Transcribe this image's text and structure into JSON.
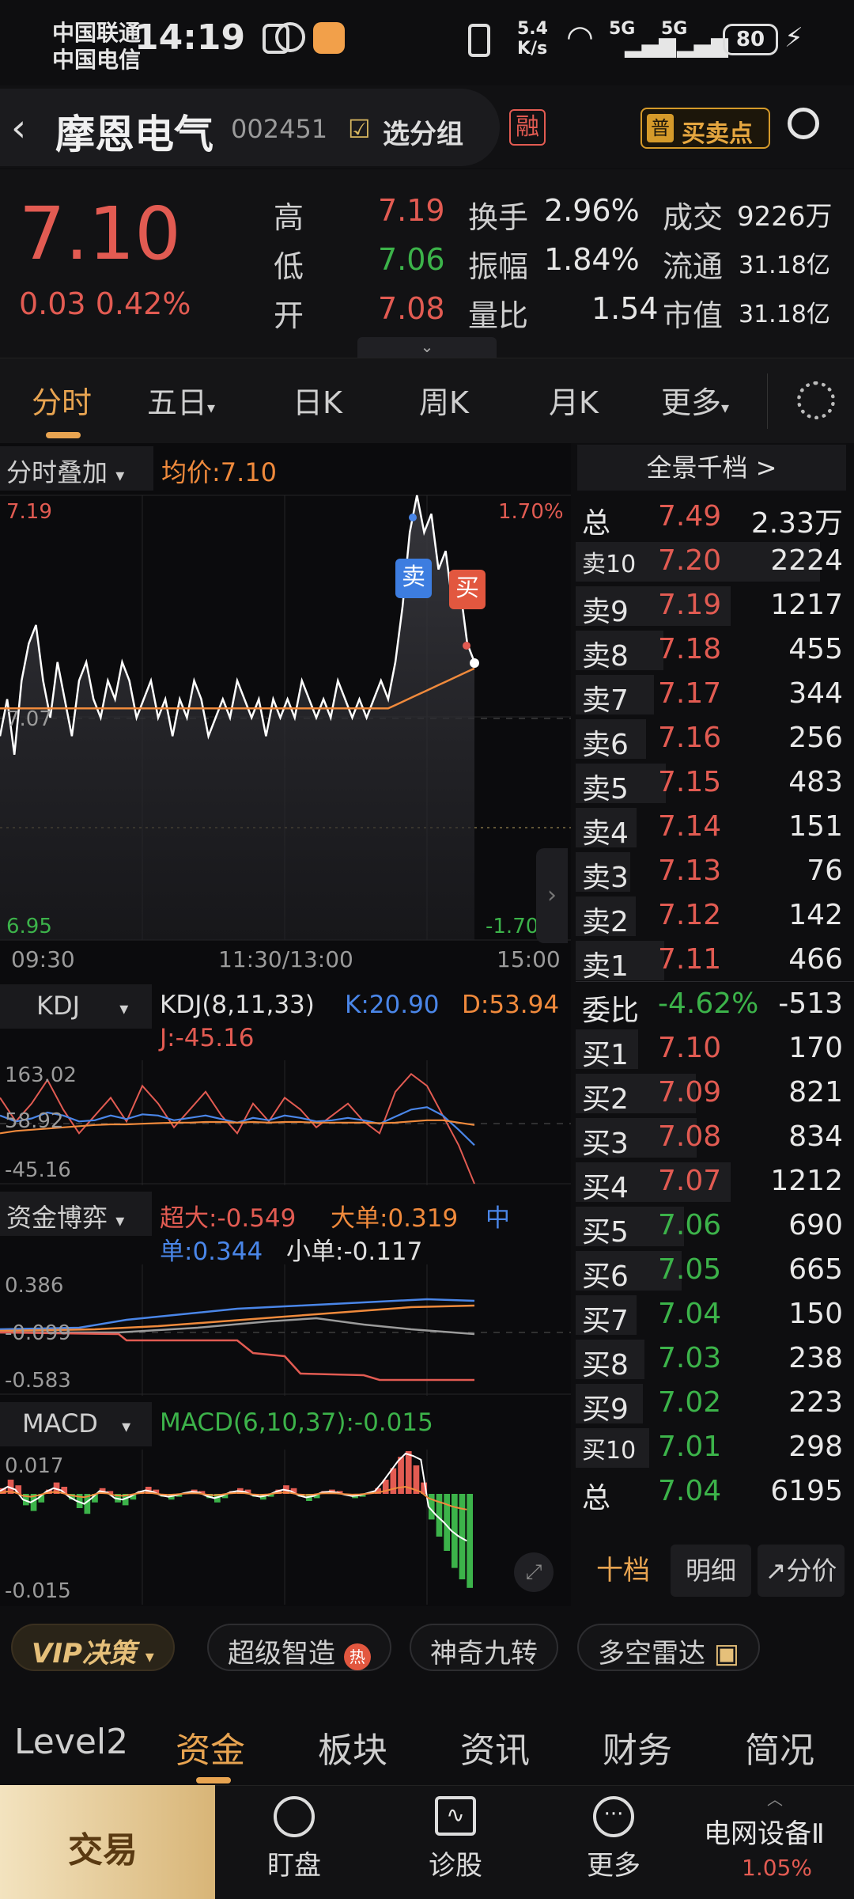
{
  "status": {
    "carrier1": "中国联通",
    "carrier2": "中国电信",
    "time": "14:19",
    "net_speed_top": "5.4",
    "net_speed_bot": "K/s",
    "sig1": "5G",
    "sig2": "5G",
    "battery": "80"
  },
  "header": {
    "name": "摩恩电气",
    "code": "002451",
    "group_label": "选分组",
    "rong": "融",
    "buysell_badge": "普",
    "buysell": "买卖点"
  },
  "quote": {
    "price": "7.10",
    "change": "0.03",
    "change_pct": "0.42%",
    "high_label": "高",
    "high": "7.19",
    "low_label": "低",
    "low": "7.06",
    "open_label": "开",
    "open": "7.08",
    "turnover_label": "换手",
    "turnover": "2.96%",
    "amp_label": "振幅",
    "amp": "1.84%",
    "vr_label": "量比",
    "vr": "1.54",
    "vol_label": "成交",
    "vol": "9226万",
    "float_label": "流通",
    "float": "31.18亿",
    "mcap_label": "市值",
    "mcap": "31.18亿"
  },
  "tabs": [
    "分时",
    "五日",
    "日K",
    "周K",
    "月K",
    "更多"
  ],
  "intraday": {
    "overlay_label": "分时叠加",
    "avg_label": "均价:7.10",
    "y_top": "7.19",
    "y_mid": "7.07",
    "y_bot": "6.95",
    "pct_top": "1.70%",
    "pct_bot": "-1.70%",
    "t0": "09:30",
    "t1": "11:30/13:00",
    "t2": "15:00",
    "sell_tag": "卖",
    "buy_tag": "买"
  },
  "kdj": {
    "label": "KDJ",
    "params": "KDJ(8,11,33)",
    "k": "K:20.90",
    "d": "D:53.94",
    "j": "J:-45.16",
    "y1": "163.02",
    "y2": "58.92",
    "y3": "-45.16"
  },
  "funds": {
    "label": "资金博弈",
    "super": "超大:-0.549",
    "large": "大单:0.319",
    "mid_a": "中",
    "mid_b": "单:0.344",
    "small": "小单:-0.117",
    "y1": "0.386",
    "y2": "-0.099",
    "y3": "-0.583"
  },
  "macd": {
    "label": "MACD",
    "params": "MACD(6,10,37):-0.015",
    "y1": "0.017",
    "y2": "-0.015"
  },
  "orderbook": {
    "title": "全景千档 >",
    "top_total": {
      "label": "总",
      "price": "7.49",
      "vol": "2.33万"
    },
    "asks": [
      {
        "label": "卖10",
        "price": "7.20",
        "vol": "2224"
      },
      {
        "label": "卖9",
        "price": "7.19",
        "vol": "1217"
      },
      {
        "label": "卖8",
        "price": "7.18",
        "vol": "455"
      },
      {
        "label": "卖7",
        "price": "7.17",
        "vol": "344"
      },
      {
        "label": "卖6",
        "price": "7.16",
        "vol": "256"
      },
      {
        "label": "卖5",
        "price": "7.15",
        "vol": "483"
      },
      {
        "label": "卖4",
        "price": "7.14",
        "vol": "151"
      },
      {
        "label": "卖3",
        "price": "7.13",
        "vol": "76"
      },
      {
        "label": "卖2",
        "price": "7.12",
        "vol": "142"
      },
      {
        "label": "卖1",
        "price": "7.11",
        "vol": "466"
      }
    ],
    "ratio": {
      "label": "委比",
      "value": "-4.62%",
      "diff": "-513"
    },
    "bids": [
      {
        "label": "买1",
        "price": "7.10",
        "vol": "170"
      },
      {
        "label": "买2",
        "price": "7.09",
        "vol": "821"
      },
      {
        "label": "买3",
        "price": "7.08",
        "vol": "834"
      },
      {
        "label": "买4",
        "price": "7.07",
        "vol": "1212"
      },
      {
        "label": "买5",
        "price": "7.06",
        "vol": "690"
      },
      {
        "label": "买6",
        "price": "7.05",
        "vol": "665"
      },
      {
        "label": "买7",
        "price": "7.04",
        "vol": "150"
      },
      {
        "label": "买8",
        "price": "7.03",
        "vol": "238"
      },
      {
        "label": "买9",
        "price": "7.02",
        "vol": "223"
      },
      {
        "label": "买10",
        "price": "7.01",
        "vol": "298"
      }
    ],
    "bot_total": {
      "label": "总",
      "price": "7.04",
      "vol": "6195"
    },
    "btns": [
      "十档",
      "明细",
      "分价"
    ]
  },
  "tags": {
    "vip": "VIP决策",
    "t1": "超级智造",
    "hot": "热",
    "t2": "神奇九转",
    "t3": "多空雷达"
  },
  "bottomtabs": [
    "Level2",
    "资金",
    "板块",
    "资讯",
    "财务",
    "简况"
  ],
  "nav": {
    "trade": "交易",
    "watch": "盯盘",
    "diag": "诊股",
    "more": "更多",
    "sector": "电网设备Ⅱ",
    "sector_pct": "1.05%"
  },
  "colors": {
    "up": "#e25b52",
    "down": "#3cb34a",
    "avg": "#f08a3c",
    "price_line": "#ffffff"
  }
}
